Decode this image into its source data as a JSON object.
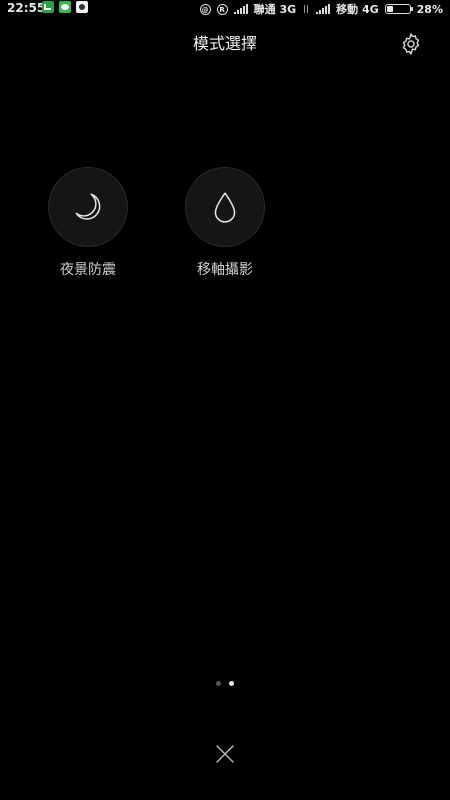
{
  "status_bar": {
    "time": "22:55",
    "carrier1": "聯通 3G",
    "carrier2": "移動 4G",
    "battery_text": "28%",
    "battery_level": 0.28,
    "icons": [
      "notification-app-icon",
      "wechat-icon",
      "app-icon",
      "at-icon",
      "registered-icon",
      "signal-icon",
      "data-arrows-icon",
      "battery-icon"
    ]
  },
  "header": {
    "title": "模式選擇",
    "settings_icon": "gear-icon"
  },
  "modes": [
    {
      "label": "夜景防震",
      "icon": "moon-icon"
    },
    {
      "label": "移軸攝影",
      "icon": "droplet-icon"
    }
  ],
  "pager": {
    "count": 2,
    "active_index": 1
  },
  "footer": {
    "close_icon": "close-icon"
  }
}
